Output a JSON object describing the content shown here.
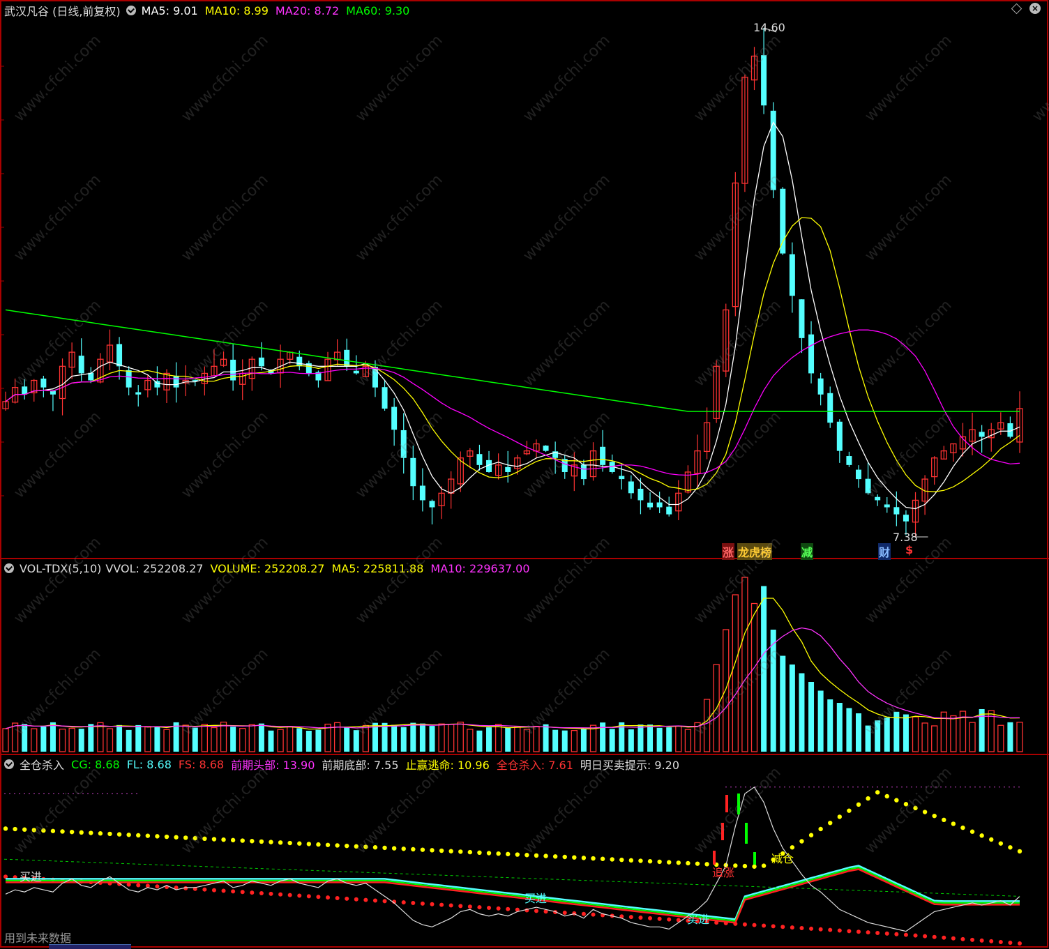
{
  "window": {
    "title": "武汉凡谷 (日线,前复权)"
  },
  "header_main": {
    "ma5": "MA5: 9.01",
    "ma10": "MA10: 8.99",
    "ma20": "MA20: 8.72",
    "ma60": "MA60: 9.30"
  },
  "header_vol": {
    "name": "VOL-TDX(5,10)",
    "vvol": "VVOL: 252208.27",
    "volume": "VOLUME: 252208.27",
    "ma5": "MA5: 225811.88",
    "ma10": "MA10: 229637.00"
  },
  "header_ind": {
    "name": "全仓杀入",
    "cg": "CG: 8.68",
    "fl": "FL: 8.68",
    "fs": "FS: 8.68",
    "prev_top": "前期头部: 13.90",
    "prev_bottom": "前期底部: 7.55",
    "take_profit": "止赢逃命: 10.96",
    "all_in": "全仓杀入: 7.61",
    "tomorrow": "明日买卖提示: 9.20"
  },
  "annotations": {
    "high": "14.60",
    "low": "7.38",
    "tag_zhang": "涨",
    "tag_longhu": "龙虎榜",
    "tag_jian": "减",
    "tag_cai": "财",
    "tag_dollar": "$",
    "buy1": "买进",
    "buy2": "买进",
    "buy3": "买进",
    "chase": "追涨",
    "reduce": "减仓"
  },
  "footer": {
    "note": "用到未来数据"
  },
  "watermark": "www.cfchi.com",
  "colors": {
    "up": "#ff3333",
    "down": "#54ffff",
    "ma5": "#ffffff",
    "ma10": "#ffff00",
    "ma20": "#ff00ff",
    "ma60": "#00ff00",
    "panel_border": "#aa0000"
  },
  "chart_data": [
    {
      "type": "candlestick",
      "title": "武汉凡谷 (日线,前复权)",
      "y_range": [
        7.38,
        14.6
      ],
      "series": [
        {
          "name": "MA5",
          "last": 9.01
        },
        {
          "name": "MA10",
          "last": 8.99
        },
        {
          "name": "MA20",
          "last": 8.72
        },
        {
          "name": "MA60",
          "last": 9.3
        }
      ],
      "close_path": [
        9.3,
        9.5,
        9.4,
        9.6,
        9.5,
        9.4,
        9.8,
        10.0,
        9.7,
        9.6,
        9.9,
        10.1,
        9.8,
        9.5,
        9.4,
        9.6,
        9.5,
        9.7,
        9.5,
        9.6,
        9.6,
        9.7,
        9.8,
        9.9,
        9.6,
        9.7,
        9.9,
        9.8,
        9.7,
        9.9,
        10.0,
        9.8,
        9.7,
        9.6,
        9.9,
        10.0,
        9.8,
        9.7,
        9.8,
        9.5,
        9.2,
        8.9,
        8.5,
        8.1,
        7.9,
        7.8,
        8.0,
        8.2,
        8.5,
        8.6,
        8.4,
        8.3,
        8.4,
        8.3,
        8.5,
        8.6,
        8.7,
        8.6,
        8.5,
        8.3,
        8.4,
        8.2,
        8.6,
        8.4,
        8.3,
        8.2,
        8.0,
        7.9,
        7.8,
        7.8,
        7.7,
        8.0,
        8.3,
        8.6,
        9.0,
        9.8,
        10.6,
        12.4,
        13.9,
        14.2,
        13.5,
        12.3,
        11.4,
        10.8,
        10.2,
        9.7,
        9.4,
        9.0,
        8.6,
        8.4,
        8.2,
        8.0,
        7.9,
        7.8,
        7.7,
        7.6,
        7.9,
        8.2,
        8.5,
        8.6,
        8.7,
        8.8,
        8.9,
        8.8,
        8.9,
        9.0,
        8.8,
        9.2
      ],
      "extremes": {
        "high": 14.6,
        "low": 7.38
      }
    },
    {
      "type": "bar",
      "title": "VOL-TDX(5,10)",
      "series": [
        {
          "name": "VVOL",
          "last": 252208.27
        },
        {
          "name": "VOLUME",
          "last": 252208.27
        },
        {
          "name": "MA5",
          "last": 225811.88
        },
        {
          "name": "MA10",
          "last": 229637.0
        }
      ]
    },
    {
      "type": "line",
      "title": "全仓杀入",
      "series": [
        {
          "name": "CG",
          "last": 8.68
        },
        {
          "name": "FL",
          "last": 8.68
        },
        {
          "name": "FS",
          "last": 8.68
        },
        {
          "name": "前期头部",
          "last": 13.9
        },
        {
          "name": "前期底部",
          "last": 7.55
        },
        {
          "name": "止赢逃命",
          "last": 10.96
        },
        {
          "name": "全仓杀入",
          "last": 7.61
        },
        {
          "name": "明日买卖提示",
          "last": 9.2
        }
      ]
    }
  ]
}
